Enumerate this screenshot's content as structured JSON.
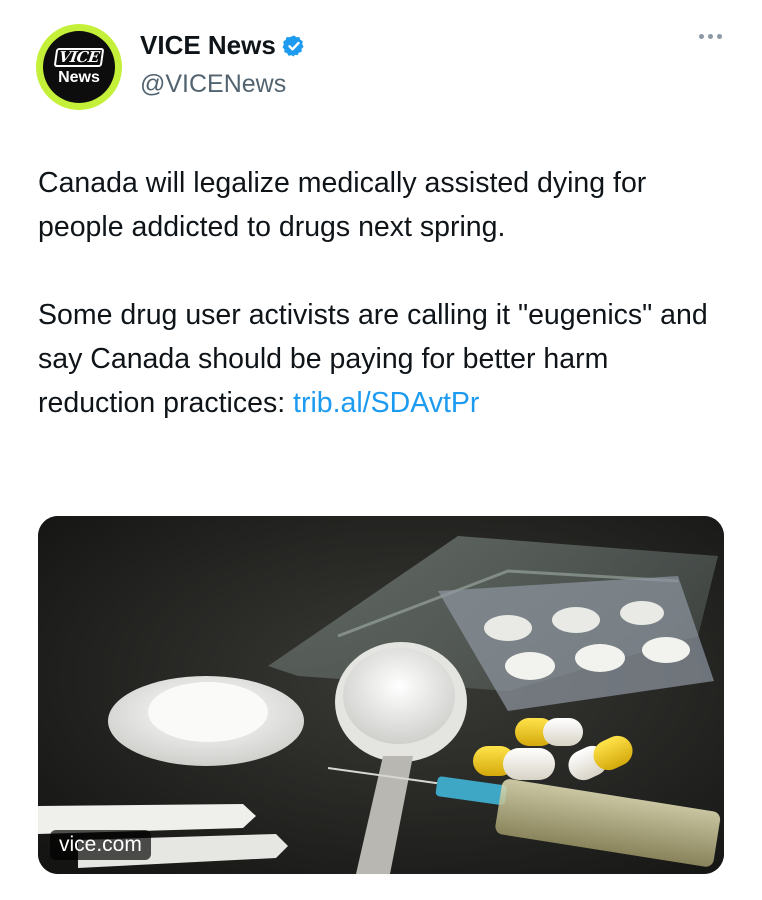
{
  "account": {
    "avatar_text_top": "VICE",
    "avatar_text_bottom": "News",
    "display_name": "VICE News",
    "handle": "@VICENews",
    "verified": true
  },
  "tweet": {
    "paragraph_1": "Canada will legalize medically assisted dying for people addicted to drugs next spring.",
    "paragraph_2_text": "Some drug user activists are calling it \"eugenics\" and say Canada should be paying for better harm reduction practices: ",
    "link_line_1": "trib.al/",
    "link_line_2": "SDAvtPr"
  },
  "media": {
    "source_label": "vice.com"
  },
  "icons": {
    "more": "more-icon",
    "verified": "verified-badge-icon"
  },
  "colors": {
    "link": "#1d9bf0",
    "avatar_ring": "#c4f03a",
    "verified": "#1d9bf0",
    "secondary_text": "#536471"
  }
}
